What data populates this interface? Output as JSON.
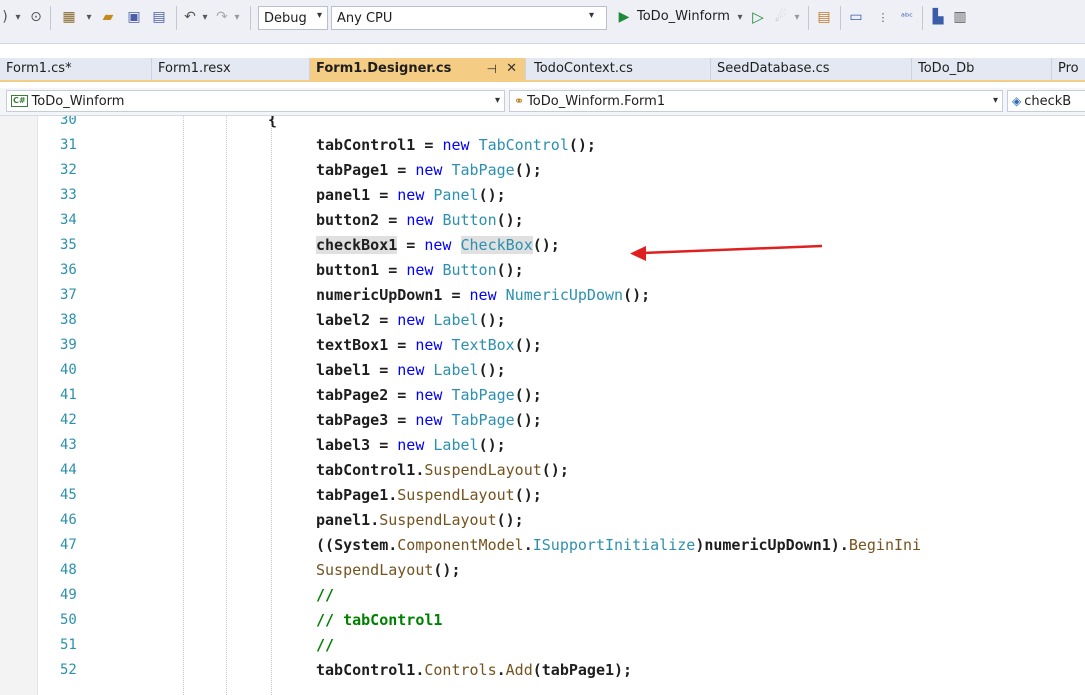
{
  "toolbar": {
    "config_value": "Debug",
    "platform_value": "Any CPU",
    "run_target_label": "ToDo_Winform",
    "dropdown_arrow": "▾"
  },
  "tabs": [
    {
      "label": "Form1.cs*"
    },
    {
      "label": "Form1.resx"
    },
    {
      "label": "Form1.Designer.cs",
      "pin": "⊣",
      "close": "✕"
    },
    {
      "label": "TodoContext.cs"
    },
    {
      "label": "SeedDatabase.cs"
    },
    {
      "label": "ToDo_Db"
    },
    {
      "label": "Pro"
    }
  ],
  "navbar": {
    "project": "ToDo_Winform",
    "project_badge": "C#",
    "type": "ToDo_Winform.Form1",
    "member": "checkB"
  },
  "editor": {
    "brace": "{",
    "lines": [
      {
        "n": "30",
        "text": ""
      },
      {
        "n": "31",
        "text": "tabControl1 = new TabControl();"
      },
      {
        "n": "32",
        "text": "tabPage1 = new TabPage();"
      },
      {
        "n": "33",
        "text": "panel1 = new Panel();"
      },
      {
        "n": "34",
        "text": "button2 = new Button();"
      },
      {
        "n": "35",
        "text": "checkBox1 = new CheckBox();"
      },
      {
        "n": "36",
        "text": "button1 = new Button();"
      },
      {
        "n": "37",
        "text": "numericUpDown1 = new NumericUpDown();"
      },
      {
        "n": "38",
        "text": "label2 = new Label();"
      },
      {
        "n": "39",
        "text": "textBox1 = new TextBox();"
      },
      {
        "n": "40",
        "text": "label1 = new Label();"
      },
      {
        "n": "41",
        "text": "tabPage2 = new TabPage();"
      },
      {
        "n": "42",
        "text": "tabPage3 = new TabPage();"
      },
      {
        "n": "43",
        "text": "label3 = new Label();"
      },
      {
        "n": "44",
        "text": "tabControl1.SuspendLayout();"
      },
      {
        "n": "45",
        "text": "tabPage1.SuspendLayout();"
      },
      {
        "n": "46",
        "text": "panel1.SuspendLayout();"
      },
      {
        "n": "47",
        "text": "((System.ComponentModel.ISupportInitialize)numericUpDown1).BeginIni"
      },
      {
        "n": "48",
        "text": "SuspendLayout();"
      },
      {
        "n": "49",
        "text": "//"
      },
      {
        "n": "50",
        "text": "// tabControl1"
      },
      {
        "n": "51",
        "text": "//"
      },
      {
        "n": "52",
        "text": "tabControl1.Controls.Add(tabPage1);"
      }
    ]
  },
  "colors": {
    "keyword": "#0000ff",
    "type": "#2b91af",
    "method": "#74531f",
    "comment": "#008000",
    "active_tab": "#f5cc84",
    "annotation_arrow": "#e02020"
  },
  "icons": {
    "annotation": "red-arrow-pointing-left"
  }
}
